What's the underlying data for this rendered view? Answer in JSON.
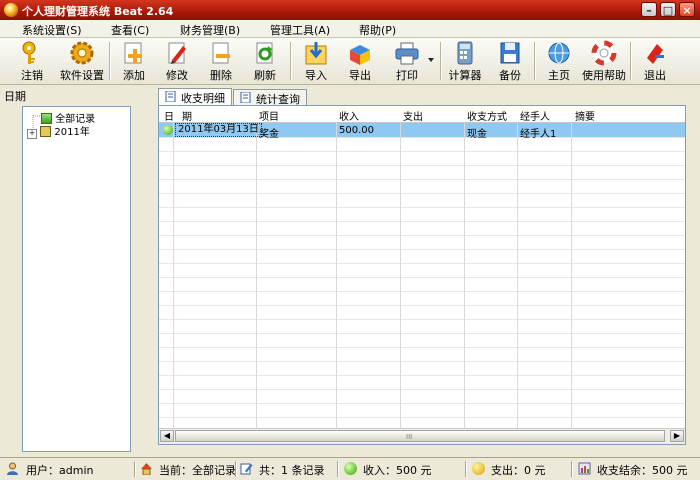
{
  "window": {
    "title": "个人理财管理系统 Beat 2.64"
  },
  "menu": [
    "系统设置(S)",
    "查看(C)",
    "财务管理(B)",
    "管理工具(A)",
    "帮助(P)"
  ],
  "toolbar": [
    "注销",
    "软件设置",
    "添加",
    "修改",
    "删除",
    "刷新",
    "导入",
    "导出",
    "打印",
    "计算器",
    "备份",
    "主页",
    "使用帮助",
    "退出"
  ],
  "tree": {
    "header": "日期",
    "root": "全部记录",
    "year": "2011年"
  },
  "tabs": [
    "收支明细",
    "统计查询"
  ],
  "grid": {
    "headers": [
      "日",
      "期",
      "项目",
      "收入",
      "支出",
      "收支方式",
      "经手人",
      "摘要"
    ],
    "rows": [
      {
        "date": "2011年03月13日",
        "item": "奖金",
        "income": "500.00",
        "expense": "",
        "method": "现金",
        "handler": "经手人1",
        "note": ""
      }
    ],
    "scroll_grip": "III"
  },
  "status": {
    "user": "用户：admin",
    "current": "当前：全部记录",
    "count": "共：1 条记录",
    "income": "收入：500 元",
    "expense": "支出：0 元",
    "balance": "收支结余：500 元"
  },
  "colors": {
    "title_bar": "#b01c0a",
    "selected_row": "#8fc8f0"
  }
}
